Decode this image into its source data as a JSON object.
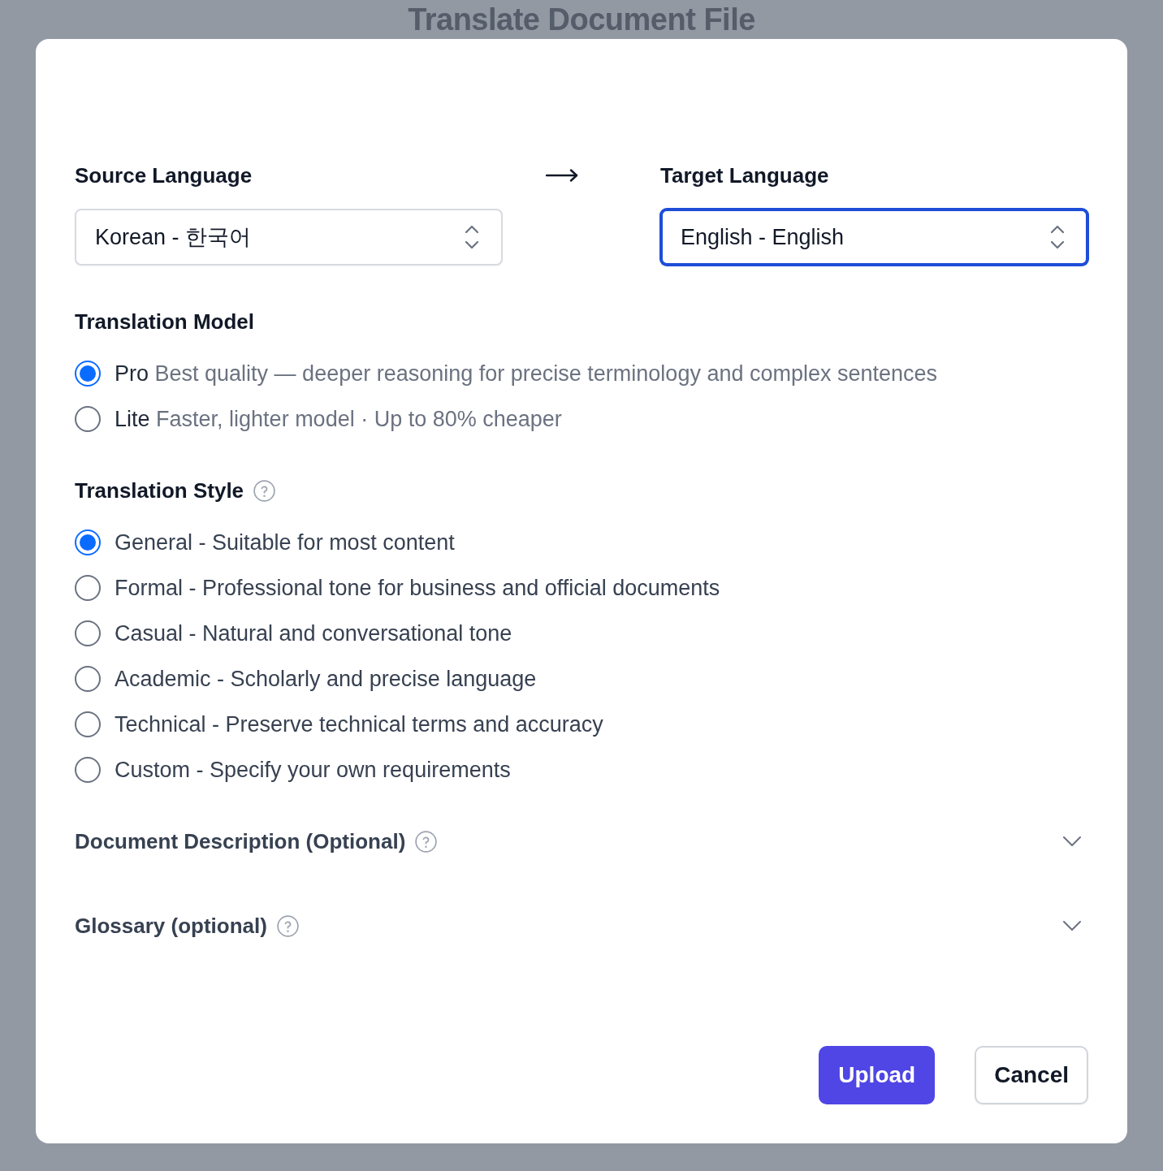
{
  "background_page": {
    "title": "Translate Document File"
  },
  "dialog": {
    "source_language": {
      "label": "Source Language",
      "value": "Korean - 한국어",
      "focused": false
    },
    "target_language": {
      "label": "Target Language",
      "value": "English - English",
      "focused": true
    },
    "translation_model": {
      "title": "Translation Model",
      "options": [
        {
          "name": "Pro",
          "description": "Best quality — deeper reasoning for precise terminology and complex sentences",
          "selected": true
        },
        {
          "name": "Lite",
          "description": "Faster, lighter model · Up to 80% cheaper",
          "selected": false
        }
      ]
    },
    "translation_style": {
      "title": "Translation Style",
      "options": [
        {
          "label": "General - Suitable for most content",
          "selected": true
        },
        {
          "label": "Formal - Professional tone for business and official documents",
          "selected": false
        },
        {
          "label": "Casual - Natural and conversational tone",
          "selected": false
        },
        {
          "label": "Academic - Scholarly and precise language",
          "selected": false
        },
        {
          "label": "Technical - Preserve technical terms and accuracy",
          "selected": false
        },
        {
          "label": "Custom - Specify your own requirements",
          "selected": false
        }
      ]
    },
    "sections": [
      {
        "title": "Document Description (Optional)",
        "expanded": false
      },
      {
        "title": "Glossary (optional)",
        "expanded": false
      }
    ],
    "buttons": [
      {
        "label": "Upload",
        "kind": "primary"
      },
      {
        "label": "Cancel",
        "kind": "secondary"
      }
    ]
  }
}
